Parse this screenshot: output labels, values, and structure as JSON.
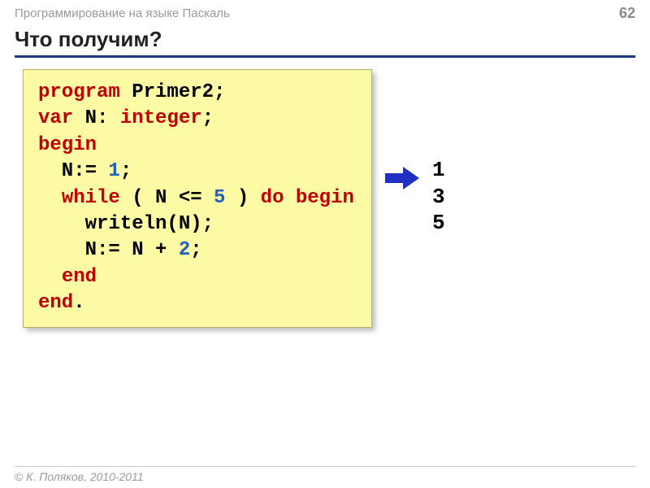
{
  "header": {
    "breadcrumb": "Программирование на языке Паскаль",
    "page_number": "62"
  },
  "title": "Что получим?",
  "code": {
    "tokens": [
      [
        {
          "t": "program ",
          "c": "kw"
        },
        {
          "t": "Primer2;",
          "c": ""
        }
      ],
      [
        {
          "t": "var ",
          "c": "kw"
        },
        {
          "t": "N: ",
          "c": ""
        },
        {
          "t": "integer",
          "c": "kw"
        },
        {
          "t": ";",
          "c": ""
        }
      ],
      [
        {
          "t": "begin",
          "c": "kw"
        }
      ],
      [
        {
          "t": "  N:= ",
          "c": ""
        },
        {
          "t": "1",
          "c": "num"
        },
        {
          "t": ";",
          "c": ""
        }
      ],
      [
        {
          "t": "  ",
          "c": ""
        },
        {
          "t": "while",
          "c": "kw"
        },
        {
          "t": " ( N <= ",
          "c": ""
        },
        {
          "t": "5",
          "c": "num"
        },
        {
          "t": " ) ",
          "c": ""
        },
        {
          "t": "do begin",
          "c": "kw"
        }
      ],
      [
        {
          "t": "    writeln(N);",
          "c": ""
        }
      ],
      [
        {
          "t": "    N:= N + ",
          "c": ""
        },
        {
          "t": "2",
          "c": "num"
        },
        {
          "t": ";",
          "c": ""
        }
      ],
      [
        {
          "t": "  ",
          "c": ""
        },
        {
          "t": "end",
          "c": "kw"
        }
      ],
      [
        {
          "t": "end",
          "c": "kw"
        },
        {
          "t": ".",
          "c": ""
        }
      ]
    ]
  },
  "output_lines": [
    "1",
    "3",
    "5"
  ],
  "footer": "© К. Поляков, 2010-2011"
}
